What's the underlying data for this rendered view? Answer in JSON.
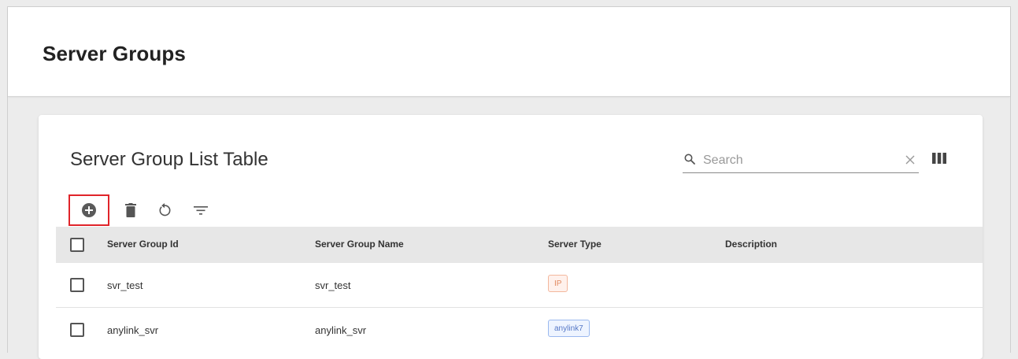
{
  "page": {
    "title": "Server Groups"
  },
  "card": {
    "title": "Server Group List Table",
    "search": {
      "placeholder": "Search",
      "value": ""
    }
  },
  "toolbar": {
    "icons": [
      "add-circle-icon",
      "delete-icon",
      "refresh-icon",
      "filter-icon"
    ]
  },
  "table": {
    "columns": [
      "Server Group Id",
      "Server Group Name",
      "Server Type",
      "Description"
    ],
    "rows": [
      {
        "id": "svr_test",
        "name": "svr_test",
        "type": "IP",
        "type_color": "#e0865c",
        "description": ""
      },
      {
        "id": "anylink_svr",
        "name": "anylink_svr",
        "type": "anylink7",
        "type_color": "#5577c6",
        "description": ""
      }
    ]
  },
  "colors": {
    "highlight_border": "#e0242a",
    "header_background": "#e7e7e7",
    "page_background": "#ececec"
  }
}
